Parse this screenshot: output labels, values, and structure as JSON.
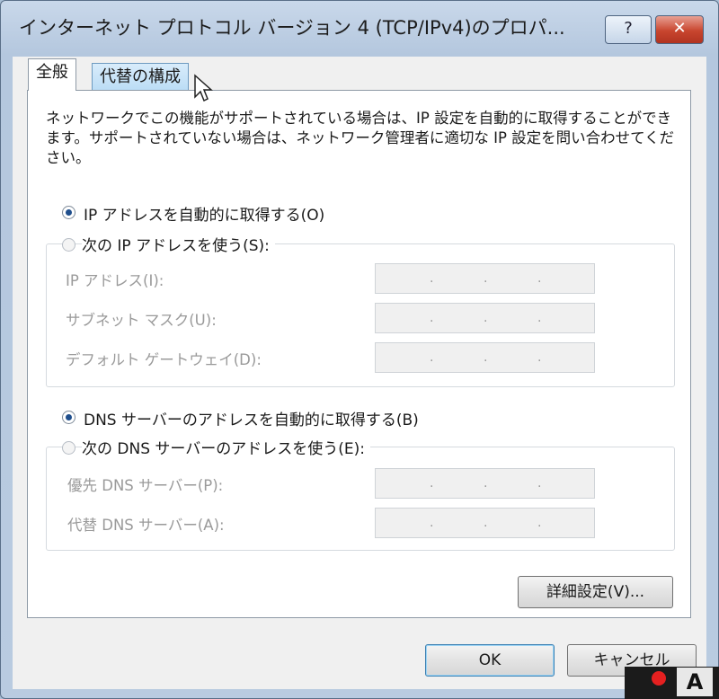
{
  "window": {
    "title": "インターネット プロトコル バージョン 4 (TCP/IPv4)のプロパ...",
    "help_label": "?",
    "close_label": "✕"
  },
  "tabs": [
    {
      "label": "全般",
      "active": true
    },
    {
      "label": "代替の構成",
      "active": false
    }
  ],
  "description": "ネットワークでこの機能がサポートされている場合は、IP 設定を自動的に取得することができます。サポートされていない場合は、ネットワーク管理者に適切な IP 設定を問い合わせてください。",
  "ip_section": {
    "auto_label": "IP アドレスを自動的に取得する(O)",
    "auto_checked": true,
    "manual_label": "次の IP アドレスを使う(S):",
    "manual_checked": false,
    "fields": [
      {
        "label": "IP アドレス(I):",
        "value": ". . ."
      },
      {
        "label": "サブネット マスク(U):",
        "value": ". . ."
      },
      {
        "label": "デフォルト ゲートウェイ(D):",
        "value": ". . ."
      }
    ]
  },
  "dns_section": {
    "auto_label": "DNS サーバーのアドレスを自動的に取得する(B)",
    "auto_checked": true,
    "manual_label": "次の DNS サーバーのアドレスを使う(E):",
    "manual_checked": false,
    "fields": [
      {
        "label": "優先 DNS サーバー(P):",
        "value": ". . ."
      },
      {
        "label": "代替 DNS サーバー(A):",
        "value": ". . ."
      }
    ]
  },
  "buttons": {
    "advanced": "詳細設定(V)...",
    "ok": "OK",
    "cancel": "キャンセル"
  },
  "tray": {
    "glyph": "A"
  }
}
